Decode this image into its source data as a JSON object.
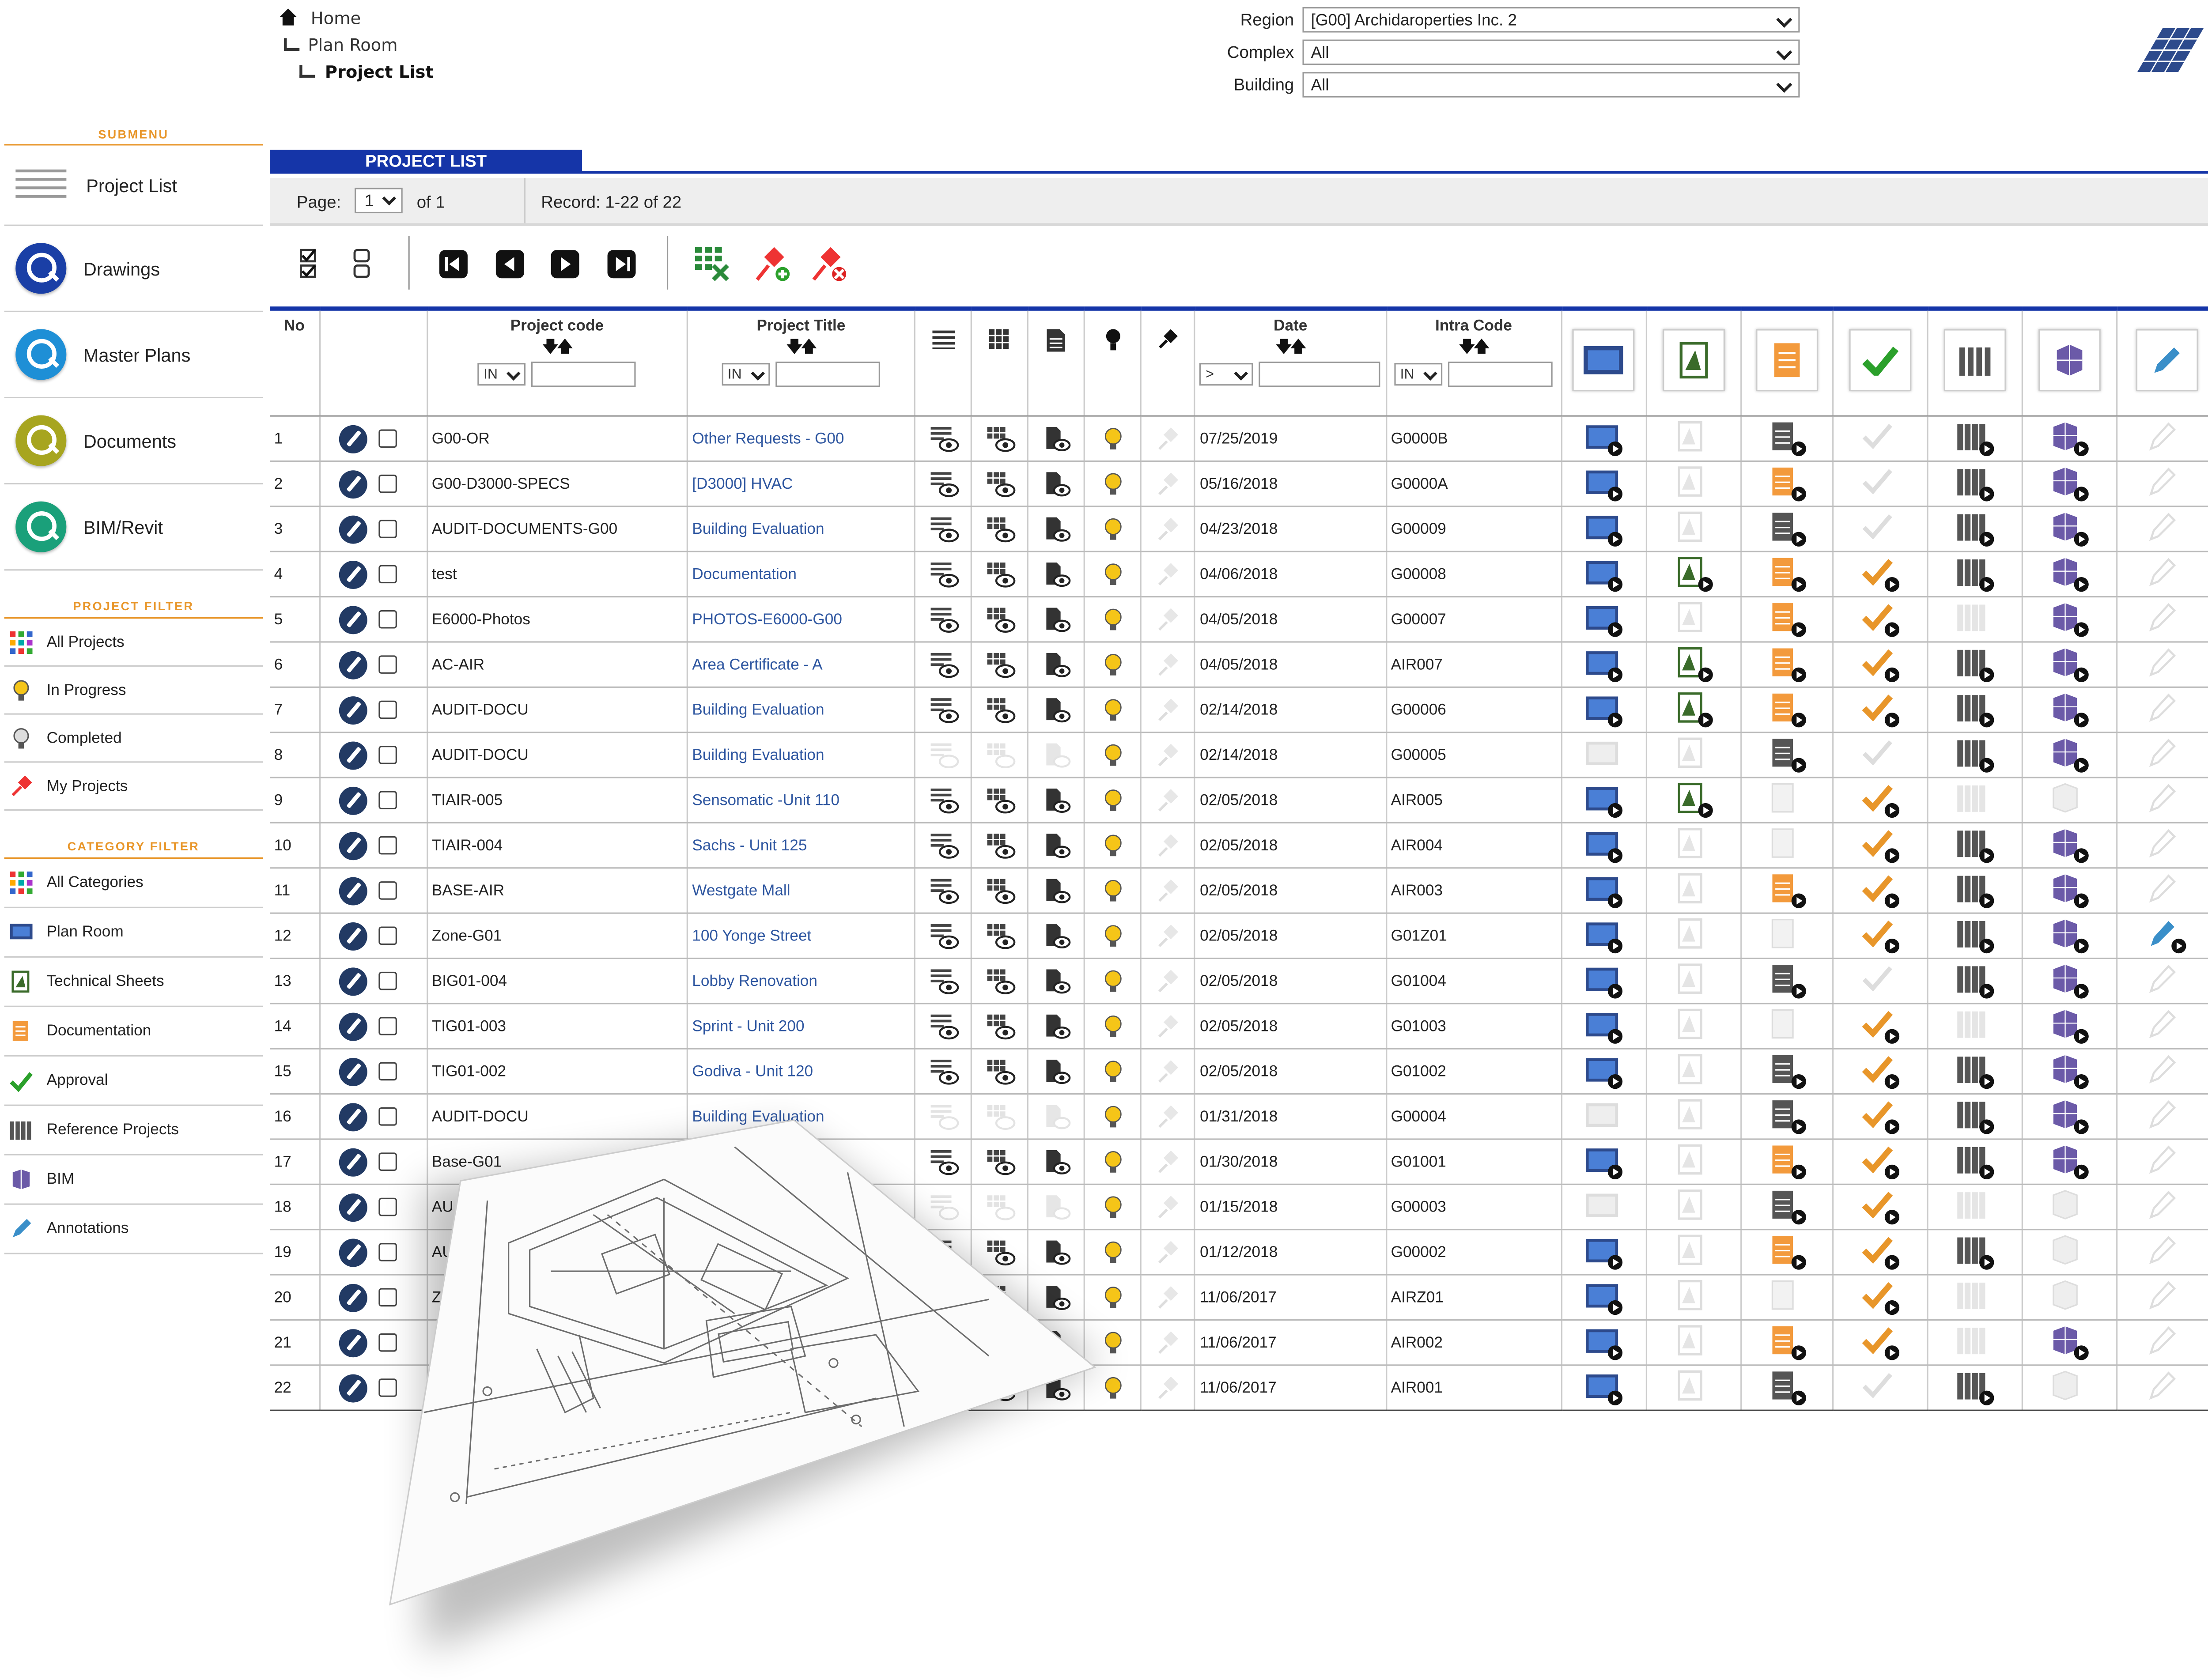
{
  "breadcrumb": {
    "home": "Home",
    "plan_room": "Plan Room",
    "current": "Project List"
  },
  "filters": {
    "region_label": "Region",
    "region_value": "[G00] Archidaroperties Inc. 2",
    "complex_label": "Complex",
    "complex_value": "All",
    "building_label": "Building",
    "building_value": "All"
  },
  "sidebar": {
    "submenu_title": "SUBMENU",
    "submenu": [
      {
        "label": "Project List",
        "icon": "list-icon"
      },
      {
        "label": "Drawings",
        "icon": "search-lens-icon",
        "color": "#1a3fa6"
      },
      {
        "label": "Master Plans",
        "icon": "search-lens-icon",
        "color": "#1e8fd6"
      },
      {
        "label": "Documents",
        "icon": "search-lens-icon",
        "color": "#a7a51f"
      },
      {
        "label": "BIM/Revit",
        "icon": "search-lens-icon",
        "color": "#1aa07a"
      }
    ],
    "project_filter_title": "PROJECT FILTER",
    "project_filter": [
      {
        "label": "All Projects",
        "icon": "grid-color-icon"
      },
      {
        "label": "In Progress",
        "icon": "bulb-on-icon"
      },
      {
        "label": "Completed",
        "icon": "bulb-off-icon"
      },
      {
        "label": "My Projects",
        "icon": "pin-icon"
      }
    ],
    "category_filter_title": "CATEGORY FILTER",
    "category_filter": [
      {
        "label": "All Categories",
        "icon": "grid-color-icon"
      },
      {
        "label": "Plan Room",
        "icon": "monitor-icon"
      },
      {
        "label": "Technical Sheets",
        "icon": "tech-sheet-icon"
      },
      {
        "label": "Documentation",
        "icon": "doc-orange-icon"
      },
      {
        "label": "Approval",
        "icon": "check-icon"
      },
      {
        "label": "Reference Projects",
        "icon": "books-icon"
      },
      {
        "label": "BIM",
        "icon": "bim-cube-icon"
      },
      {
        "label": "Annotations",
        "icon": "pencil-icon"
      }
    ]
  },
  "panel": {
    "title": "PROJECT LIST",
    "page_label": "Page:",
    "page_value": "1",
    "of_label": "of 1",
    "record_label": "Record: 1-22 of 22"
  },
  "table": {
    "headers": {
      "no": "No",
      "code": "Project code",
      "title": "Project Title",
      "date": "Date",
      "intra": "Intra Code",
      "op_in": "IN",
      "op_gt": ">"
    },
    "rows": [
      {
        "no": "1",
        "code": "G00-OR",
        "title": "Other Requests - G00",
        "date": "07/25/2019",
        "intra": "G0000B",
        "s": [
          1,
          0,
          2,
          0,
          1,
          1,
          0
        ]
      },
      {
        "no": "2",
        "code": "G00-D3000-SPECS",
        "title": "[D3000] HVAC",
        "date": "05/16/2018",
        "intra": "G0000A",
        "s": [
          1,
          0,
          1,
          0,
          1,
          1,
          0
        ]
      },
      {
        "no": "3",
        "code": "AUDIT-DOCUMENTS-G00",
        "title": "Building Evaluation",
        "date": "04/23/2018",
        "intra": "G00009",
        "s": [
          1,
          0,
          2,
          0,
          1,
          1,
          0
        ]
      },
      {
        "no": "4",
        "code": "test",
        "title": "Documentation",
        "date": "04/06/2018",
        "intra": "G00008",
        "s": [
          1,
          1,
          1,
          1,
          1,
          1,
          0
        ]
      },
      {
        "no": "5",
        "code": "E6000-Photos",
        "title": "PHOTOS-E6000-G00",
        "date": "04/05/2018",
        "intra": "G00007",
        "s": [
          1,
          0,
          1,
          1,
          0,
          1,
          0
        ]
      },
      {
        "no": "6",
        "code": "AC-AIR",
        "title": "Area Certificate - A",
        "date": "04/05/2018",
        "intra": "AIR007",
        "s": [
          1,
          1,
          1,
          1,
          1,
          1,
          0
        ]
      },
      {
        "no": "7",
        "code": "AUDIT-DOCU",
        "title": "Building Evaluation",
        "date": "02/14/2018",
        "intra": "G00006",
        "s": [
          1,
          1,
          1,
          1,
          1,
          1,
          0
        ]
      },
      {
        "no": "8",
        "code": "AUDIT-DOCU",
        "title": "Building Evaluation",
        "date": "02/14/2018",
        "intra": "G00005",
        "s": [
          0,
          0,
          2,
          0,
          1,
          1,
          0
        ]
      },
      {
        "no": "9",
        "code": "TIAIR-005",
        "title": "Sensomatic -Unit 110",
        "date": "02/05/2018",
        "intra": "AIR005",
        "s": [
          1,
          1,
          0,
          1,
          0,
          0,
          0
        ]
      },
      {
        "no": "10",
        "code": "TIAIR-004",
        "title": "Sachs - Unit 125",
        "date": "02/05/2018",
        "intra": "AIR004",
        "s": [
          1,
          0,
          0,
          1,
          1,
          1,
          0
        ]
      },
      {
        "no": "11",
        "code": "BASE-AIR",
        "title": "Westgate Mall",
        "date": "02/05/2018",
        "intra": "AIR003",
        "s": [
          1,
          0,
          1,
          1,
          1,
          1,
          0
        ]
      },
      {
        "no": "12",
        "code": "Zone-G01",
        "title": "100 Yonge Street",
        "date": "02/05/2018",
        "intra": "G01Z01",
        "s": [
          1,
          0,
          0,
          1,
          1,
          1,
          1
        ]
      },
      {
        "no": "13",
        "code": "BIG01-004",
        "title": "Lobby Renovation",
        "date": "02/05/2018",
        "intra": "G01004",
        "s": [
          1,
          0,
          2,
          0,
          1,
          1,
          0
        ]
      },
      {
        "no": "14",
        "code": "TIG01-003",
        "title": "Sprint - Unit 200",
        "date": "02/05/2018",
        "intra": "G01003",
        "s": [
          1,
          0,
          0,
          1,
          0,
          1,
          0
        ]
      },
      {
        "no": "15",
        "code": "TIG01-002",
        "title": "Godiva - Unit 120",
        "date": "02/05/2018",
        "intra": "G01002",
        "s": [
          1,
          0,
          2,
          1,
          1,
          1,
          0
        ]
      },
      {
        "no": "16",
        "code": "AUDIT-DOCU",
        "title": "Building Evaluation",
        "date": "01/31/2018",
        "intra": "G00004",
        "s": [
          0,
          0,
          2,
          1,
          1,
          1,
          0
        ]
      },
      {
        "no": "17",
        "code": "Base-G01",
        "title": "",
        "date": "01/30/2018",
        "intra": "G01001",
        "s": [
          1,
          0,
          1,
          1,
          1,
          1,
          0
        ]
      },
      {
        "no": "18",
        "code": "AU",
        "title": "",
        "date": "01/15/2018",
        "intra": "G00003",
        "s": [
          0,
          0,
          2,
          1,
          0,
          0,
          0
        ]
      },
      {
        "no": "19",
        "code": "AU",
        "title": "",
        "date": "01/12/2018",
        "intra": "G00002",
        "s": [
          1,
          0,
          1,
          1,
          1,
          0,
          0
        ]
      },
      {
        "no": "20",
        "code": "Z",
        "title": "",
        "date": "11/06/2017",
        "intra": "AIRZ01",
        "s": [
          1,
          0,
          0,
          1,
          0,
          0,
          0
        ]
      },
      {
        "no": "21",
        "code": "",
        "title": "",
        "date": "11/06/2017",
        "intra": "AIR002",
        "s": [
          1,
          0,
          1,
          1,
          0,
          1,
          0
        ]
      },
      {
        "no": "22",
        "code": "",
        "title": "",
        "date": "11/06/2017",
        "intra": "AIR001",
        "s": [
          1,
          0,
          2,
          0,
          1,
          0,
          0
        ]
      }
    ]
  },
  "colors": {
    "brand_blue": "#1535a8",
    "accent_orange": "#e8962a",
    "link_blue": "#2e56a0"
  }
}
